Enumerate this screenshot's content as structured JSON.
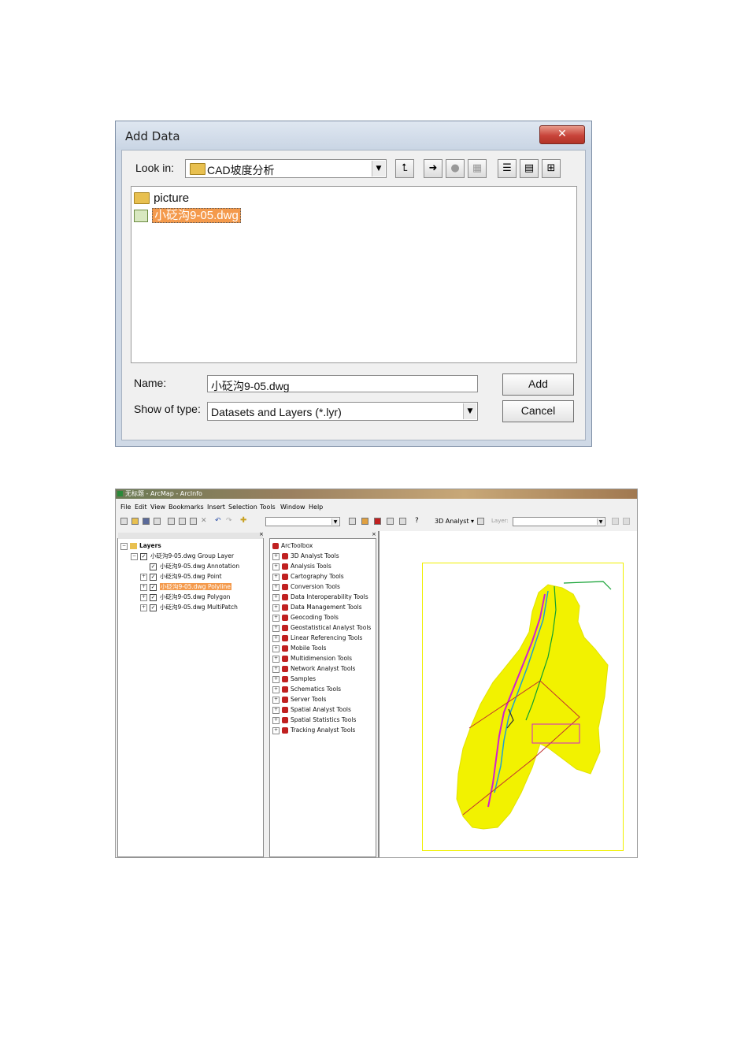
{
  "add_data_dialog": {
    "title": "Add Data",
    "close_glyph": "✕",
    "look_in_label": "Look in:",
    "look_in_value": "CAD坡度分析",
    "files": [
      "picture",
      "小砭沟9-05.dwg"
    ],
    "name_label": "Name:",
    "name_value": "小砭沟9-05.dwg",
    "type_label": "Show of type:",
    "type_value": "Datasets and Layers (*.lyr)",
    "add_button": "Add",
    "cancel_button": "Cancel"
  },
  "arcmap": {
    "window_title": "无标题 - ArcMap - ArcInfo",
    "menu": [
      "File",
      "Edit",
      "View",
      "Bookmarks",
      "Insert",
      "Selection",
      "Tools",
      "Window",
      "Help"
    ],
    "toolbar": {
      "analyst_label": "3D Analyst ▾",
      "layer_label": "Layer:"
    },
    "toc": {
      "root": "Layers",
      "group": "小砭沟9-05.dwg Group Layer",
      "layers": [
        "小砭沟9-05.dwg Annotation",
        "小砭沟9-05.dwg Point",
        "小砭沟9-05.dwg Polyline",
        "小砭沟9-05.dwg Polygon",
        "小砭沟9-05.dwg MultiPatch"
      ]
    },
    "toolbox": {
      "root": "ArcToolbox",
      "items": [
        "3D Analyst Tools",
        "Analysis Tools",
        "Cartography Tools",
        "Conversion Tools",
        "Data Interoperability Tools",
        "Data Management Tools",
        "Geocoding Tools",
        "Geostatistical Analyst Tools",
        "Linear Referencing Tools",
        "Mobile Tools",
        "Multidimension Tools",
        "Network Analyst Tools",
        "Samples",
        "Schematics Tools",
        "Server Tools",
        "Spatial Analyst Tools",
        "Spatial Statistics Tools",
        "Tracking Analyst Tools"
      ]
    },
    "colors": {
      "selection": "#f49a4c",
      "map_fill": "#f2f200",
      "map_frame": "#f0f000"
    }
  }
}
